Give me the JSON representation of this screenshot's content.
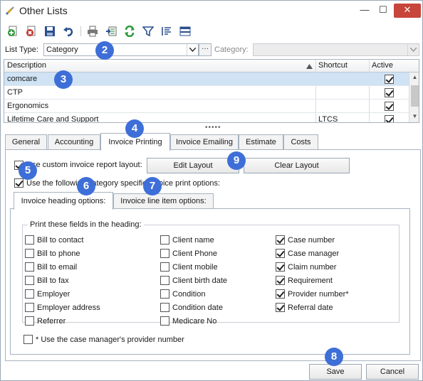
{
  "window": {
    "title": "Other Lists",
    "min_glyph": "—",
    "max_glyph": "☐",
    "close_glyph": "✕"
  },
  "toolbar": {
    "buttons": [
      {
        "name": "add-icon",
        "color": "#2c9a3a"
      },
      {
        "name": "delete-icon",
        "color": "#c3322a"
      },
      {
        "name": "save-icon",
        "color": "#2a4f8f"
      },
      {
        "name": "undo-icon",
        "color": "#2a4f8f"
      },
      {
        "name": "print-icon",
        "color": "#555555"
      },
      {
        "name": "export-icon",
        "color": "#2c7a3a"
      },
      {
        "name": "refresh-icon",
        "color": "#2c9a3a"
      },
      {
        "name": "filter-icon",
        "color": "#2a4f8f"
      },
      {
        "name": "sort-icon",
        "color": "#2a4f8f"
      },
      {
        "name": "layout-icon",
        "color": "#2a4f8f"
      }
    ]
  },
  "list_type": {
    "label": "List Type:",
    "value": "Category",
    "dots": "···",
    "category_label": "Category:",
    "category_value": ""
  },
  "grid": {
    "columns": [
      "Description",
      "Shortcut",
      "Active"
    ],
    "rows": [
      {
        "description": "comcare",
        "shortcut": "",
        "active": true
      },
      {
        "description": "CTP",
        "shortcut": "",
        "active": true
      },
      {
        "description": "Ergonomics",
        "shortcut": "",
        "active": true
      },
      {
        "description": "Lifetime Care and Support",
        "shortcut": "LTCS",
        "active": true
      }
    ]
  },
  "splitter": "•••••",
  "tabs": [
    "General",
    "Accounting",
    "Invoice Printing",
    "Invoice Emailing",
    "Estimate",
    "Costs"
  ],
  "active_tab": "Invoice Printing",
  "invoice_printing": {
    "custom_layout_label": "Use custom invoice report layout:",
    "custom_layout_checked": true,
    "edit_layout": "Edit Layout",
    "clear_layout": "Clear Layout",
    "category_specific_label": "Use the following category specific invoice print options:",
    "category_specific_checked": true,
    "subtabs": [
      "Invoice heading options:",
      "Invoice line item options:"
    ],
    "heading_group_label": "Print these fields in the heading:",
    "fields_col1": [
      {
        "label": "Bill to contact",
        "checked": false
      },
      {
        "label": "Bill to phone",
        "checked": false
      },
      {
        "label": "Bill to email",
        "checked": false
      },
      {
        "label": "Bill to fax",
        "checked": false
      },
      {
        "label": "Employer",
        "checked": false
      },
      {
        "label": "Employer address",
        "checked": false
      },
      {
        "label": "Referrer",
        "checked": false
      }
    ],
    "fields_col2": [
      {
        "label": "Client name",
        "checked": false
      },
      {
        "label": "Client Phone",
        "checked": false
      },
      {
        "label": "Client mobile",
        "checked": false
      },
      {
        "label": "Client birth date",
        "checked": false
      },
      {
        "label": "Condition",
        "checked": false
      },
      {
        "label": "Condition date",
        "checked": false
      },
      {
        "label": "Medicare No",
        "checked": false
      }
    ],
    "fields_col3": [
      {
        "label": "Case number",
        "checked": true
      },
      {
        "label": "Case manager",
        "checked": true
      },
      {
        "label": "Claim number",
        "checked": true
      },
      {
        "label": "Requirement",
        "checked": true
      },
      {
        "label": "Provider number*",
        "checked": true
      },
      {
        "label": "Referral date",
        "checked": true
      }
    ],
    "provider_note_label": "* Use the case manager's provider number",
    "provider_note_checked": false
  },
  "footer": {
    "save": "Save",
    "cancel": "Cancel"
  },
  "badges": [
    "2",
    "3",
    "4",
    "5",
    "6",
    "7",
    "8",
    "9"
  ]
}
